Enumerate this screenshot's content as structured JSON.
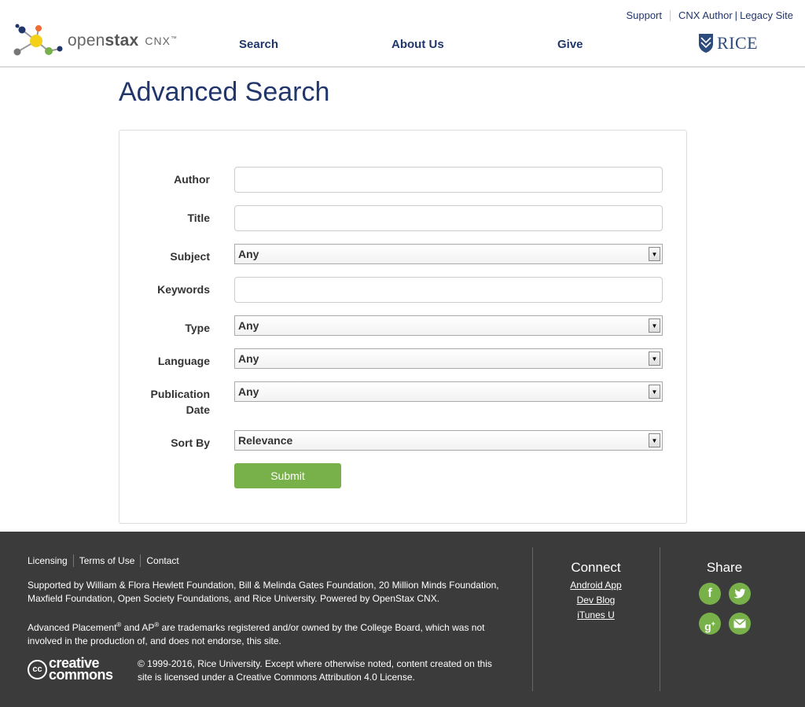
{
  "utility": {
    "support": "Support",
    "cnx_author": "CNX Author",
    "legacy": "Legacy Site"
  },
  "logo": {
    "open": "open",
    "stax": "stax",
    "cnx": "CNX",
    "tm": "™"
  },
  "nav": {
    "search": "Search",
    "about": "About Us",
    "give": "Give"
  },
  "rice": {
    "text": "RICE"
  },
  "page": {
    "title": "Advanced Search"
  },
  "form": {
    "author_label": "Author",
    "title_label": "Title",
    "subject_label": "Subject",
    "subject_value": "Any",
    "keywords_label": "Keywords",
    "type_label": "Type",
    "type_value": "Any",
    "language_label": "Language",
    "language_value": "Any",
    "pubdate_label_1": "Publication",
    "pubdate_label_2": "Date",
    "pubdate_value": "Any",
    "sortby_label": "Sort By",
    "sortby_value": "Relevance",
    "submit_label": "Submit"
  },
  "footer": {
    "links": [
      "Licensing",
      "Terms of Use",
      "Contact"
    ],
    "supported": "Supported by William & Flora Hewlett Foundation, Bill & Melinda Gates Foundation, 20 Million Minds Foundation, Maxfield Foundation, Open Society Foundations, and Rice University. Powered by OpenStax CNX.",
    "ap_1": "Advanced Placement",
    "ap_2": " and AP",
    "ap_3": " are trademarks registered and/or owned by the College Board, which was not involved in the production of, and does not endorse, this site.",
    "reg": "®",
    "cc_line1": "creative",
    "cc_line2": "commons",
    "cc_badge": "cc",
    "copyright": "© 1999-2016, Rice University. Except where otherwise noted, content created on this site is licensed under a Creative Commons Attribution 4.0 License.",
    "connect_title": "Connect",
    "connect_items": [
      "Android App",
      "Dev Blog",
      "iTunes U"
    ],
    "share_title": "Share",
    "share_icons": [
      "facebook-icon",
      "twitter-icon",
      "google-plus-icon",
      "email-icon"
    ]
  },
  "colors": {
    "brand_blue": "#21366b",
    "green": "#78b04a",
    "footer_bg": "#3b3b3b"
  }
}
